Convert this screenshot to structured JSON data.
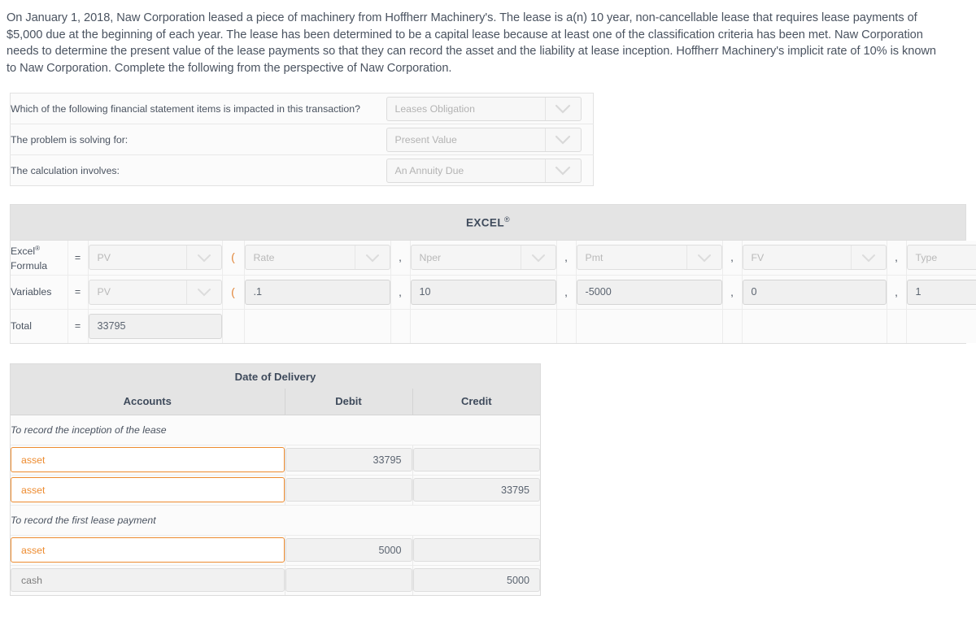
{
  "intro": {
    "text": "On January 1, 2018, Naw Corporation leased a piece of machinery from Hoffherr Machinery's. The lease is a(n) 10 year, non-cancellable lease that requires lease payments of $5,000 due at the beginning of each year. The lease has been determined to be a capital lease because at least one of the classification criteria has been met. Naw Corporation needs to determine the present value of the lease payments so that they can record the asset and the liability at lease inception. Hoffherr Machinery's implicit rate of 10% is known to Naw Corporation. Complete the following from the perspective of Naw Corporation."
  },
  "questions": [
    {
      "label": "Which of the following financial statement items is impacted in this transaction?",
      "value": "Leases Obligation",
      "icon": "chevron-down-icon"
    },
    {
      "label": "The problem is solving for:",
      "value": "Present Value",
      "icon": "chevron-down-icon"
    },
    {
      "label": "The calculation involves:",
      "value": "An Annuity Due",
      "icon": "chevron-down-icon"
    }
  ],
  "excel": {
    "title": "EXCEL",
    "title_sup": "®",
    "rows": {
      "formula": {
        "label_main": "Excel",
        "label_sup": "®",
        "label_second": "Formula",
        "equals": "=",
        "pv": "PV",
        "open_paren": "(",
        "rate": "Rate",
        "comma1": ",",
        "nper": "Nper",
        "comma2": ",",
        "pmt": "Pmt",
        "comma3": ",",
        "fv": "FV",
        "comma4": ",",
        "type": "Type",
        "close_paren": ")"
      },
      "variables": {
        "label": "Variables",
        "equals": "=",
        "pv": "PV",
        "open_paren": "(",
        "rate": ".1",
        "comma1": ",",
        "nper": "10",
        "comma2": ",",
        "pmt": "-5000",
        "comma3": ",",
        "fv": "0",
        "comma4": ",",
        "type": "1",
        "close_paren": ")"
      },
      "total": {
        "label": "Total",
        "equals": "=",
        "value": "33795"
      }
    }
  },
  "journal": {
    "title": "Date of Delivery",
    "headers": {
      "accounts": "Accounts",
      "debit": "Debit",
      "credit": "Credit"
    },
    "sections": [
      {
        "memo": "To record the inception of the lease",
        "entries": [
          {
            "account": "asset",
            "account_state": "active",
            "debit": "33795",
            "credit": ""
          },
          {
            "account": "asset",
            "account_state": "active",
            "debit": "",
            "credit": "33795"
          }
        ]
      },
      {
        "memo": "To record the first lease payment",
        "entries": [
          {
            "account": "asset",
            "account_state": "active",
            "debit": "5000",
            "credit": ""
          },
          {
            "account": "cash",
            "account_state": "normal",
            "debit": "",
            "credit": "5000"
          }
        ]
      }
    ]
  },
  "colors": {
    "accent_orange": "#ed8b2f",
    "header_gray": "#e4e4e4",
    "text_slate": "#4a5360"
  }
}
